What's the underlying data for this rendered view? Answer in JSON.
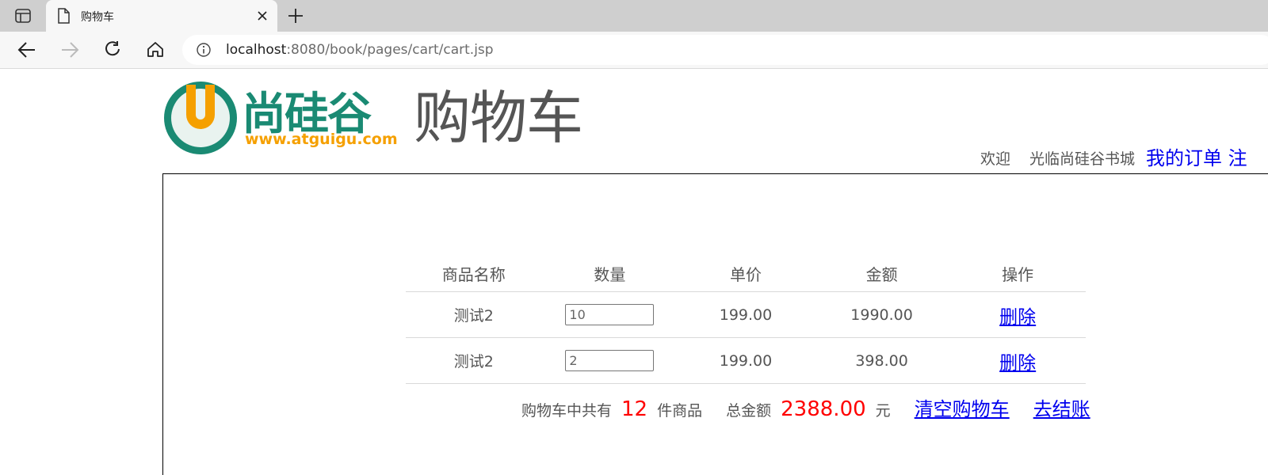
{
  "browser": {
    "tab_title": "购物车",
    "url_host": "localhost",
    "url_rest": ":8080/book/pages/cart/cart.jsp"
  },
  "header": {
    "logo_text": "尚硅谷",
    "logo_url": "www.atguigu.com",
    "page_title": "购物车",
    "welcome_text": "欢迎",
    "welcome_site": "光临尚硅谷书城",
    "my_orders": "我的订单 注"
  },
  "cart": {
    "columns": [
      "商品名称",
      "数量",
      "单价",
      "金额",
      "操作"
    ],
    "items": [
      {
        "name": "测试2",
        "quantity": "10",
        "price": "199.00",
        "total": "1990.00",
        "action": "删除"
      },
      {
        "name": "测试2",
        "quantity": "2",
        "price": "199.00",
        "total": "398.00",
        "action": "删除"
      }
    ],
    "summary": {
      "count_prefix": "购物车中共有",
      "count": "12",
      "count_suffix": "件商品",
      "total_prefix": "总金额",
      "total": "2388.00",
      "total_suffix": "元",
      "clear_label": "清空购物车",
      "checkout_label": "去结账"
    }
  },
  "colors": {
    "highlight": "#ff0000",
    "link": "#0000ee",
    "logo_green": "#1a8a73",
    "logo_orange": "#f5a000"
  }
}
